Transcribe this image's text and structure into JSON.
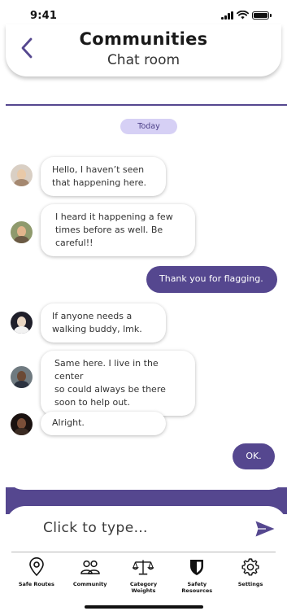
{
  "status_bar": {
    "time": "9:41"
  },
  "header": {
    "title": "Communities",
    "subtitle": "Chat room",
    "back_icon": "chevron-left-icon"
  },
  "colors": {
    "accent": "#55478f",
    "chip_bg": "#d6d0f5",
    "chip_text": "#4b3f87"
  },
  "chat": {
    "date_chip": "Today",
    "messages": [
      {
        "id": "m1",
        "direction": "received",
        "lines": [
          "Hello, I haven’t seen",
          "that happening here."
        ]
      },
      {
        "id": "m2",
        "direction": "received",
        "lines": [
          "I heard it happening a few",
          "times before as well. Be",
          "careful!!"
        ]
      },
      {
        "id": "m3",
        "direction": "sent",
        "lines": [
          "Thank you for flagging."
        ]
      },
      {
        "id": "m4",
        "direction": "received",
        "lines": [
          "If anyone needs a",
          "walking buddy, lmk."
        ]
      },
      {
        "id": "m5",
        "direction": "received",
        "lines": [
          "Same here. I live in the center",
          "so could always be there",
          "soon to help out."
        ]
      },
      {
        "id": "m6",
        "direction": "received",
        "lines": [
          "Alright."
        ]
      },
      {
        "id": "m7",
        "direction": "sent",
        "lines": [
          "OK."
        ]
      }
    ]
  },
  "composer": {
    "placeholder": "Click to type…",
    "send_icon": "send-icon"
  },
  "tabs": [
    {
      "label_lines": [
        "Safe Routes"
      ],
      "icon": "map-pin-icon"
    },
    {
      "label_lines": [
        "Community"
      ],
      "icon": "people-icon"
    },
    {
      "label_lines": [
        "Category",
        "Weights"
      ],
      "icon": "scale-icon"
    },
    {
      "label_lines": [
        "Safety",
        "Resources"
      ],
      "icon": "shield-icon"
    },
    {
      "label_lines": [
        "Settings"
      ],
      "icon": "gear-icon"
    }
  ]
}
